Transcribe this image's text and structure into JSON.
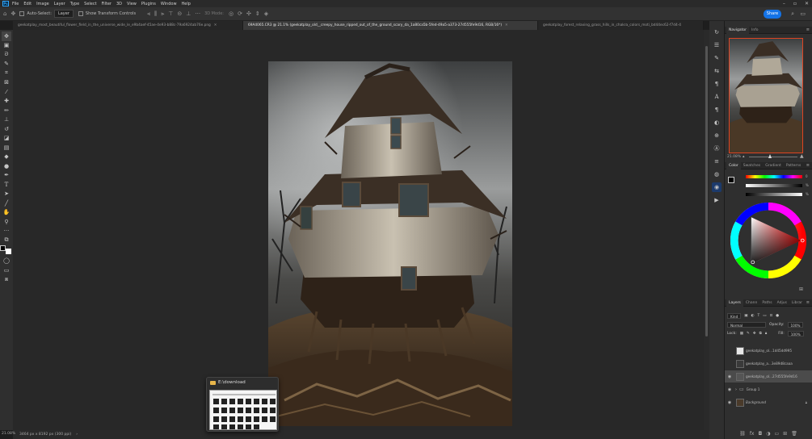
{
  "menu": [
    "File",
    "Edit",
    "Image",
    "Layer",
    "Type",
    "Select",
    "Filter",
    "3D",
    "View",
    "Plugins",
    "Window",
    "Help"
  ],
  "options": {
    "auto_select_label": "Auto-Select:",
    "auto_select_value": "Layer",
    "transform_label": "Show Transform Controls",
    "mode_3d_label": "3D Mode:",
    "share_label": "Share"
  },
  "tabs": [
    {
      "label": "geekatplay_most_beautiful_flower_field_in_the_universe_wide_le_e9b4aef-45ae-4e93-b88c-79a6924ab76e.png",
      "active": false
    },
    {
      "label": "69A4065.CR3 @ 21.1% (geekatplay_old__creepy_house_ripped_out_of_the_ground_scary_da_1a80ca5b-5fed-49a5-a373-27d555fe9d16, RGB/16*)",
      "active": true
    },
    {
      "label": "geekatplay_forest_relaxing_grass_hills_in_chakra_colors_moti_bd44ec62-f7d4-4",
      "active": false
    }
  ],
  "status": {
    "zoom": "21.08%",
    "doc_size": "3464 px x 8192 px (300 ppi)"
  },
  "popup": {
    "title": "E:\\download"
  },
  "panels": {
    "nav_tabs": [
      "Navigator",
      "Info"
    ],
    "nav_zoom": "21.08%",
    "color_tabs": [
      "Color",
      "Swatches",
      "Gradient",
      "Patterns"
    ],
    "color_values": [
      "0",
      "%",
      "%"
    ],
    "layer_tabs": [
      "Layers",
      "Chann",
      "Paths",
      "Adjus",
      "Librar"
    ],
    "layer_kind": "Kind",
    "blend_mode": "Normal",
    "opacity_label": "Opacity:",
    "opacity_value": "100%",
    "lock_label": "Lock:",
    "fill_label": "Fill:",
    "fill_value": "100%"
  },
  "layers": [
    {
      "name": "geekatplay_ol...1d45dd995",
      "visible": false,
      "selected": false
    },
    {
      "name": "geekatplay_a...3e89d8caaa",
      "visible": false,
      "selected": false
    },
    {
      "name": "geekatplay_ol...27d555fe9d16",
      "visible": true,
      "selected": true
    },
    {
      "name": "Group 1",
      "visible": true,
      "selected": false,
      "group": true
    },
    {
      "name": "Background",
      "visible": true,
      "selected": false,
      "locked": true
    }
  ],
  "colors": {
    "accent": "#1473e6",
    "panel": "#2f2f2f",
    "canvas": "#282828"
  }
}
